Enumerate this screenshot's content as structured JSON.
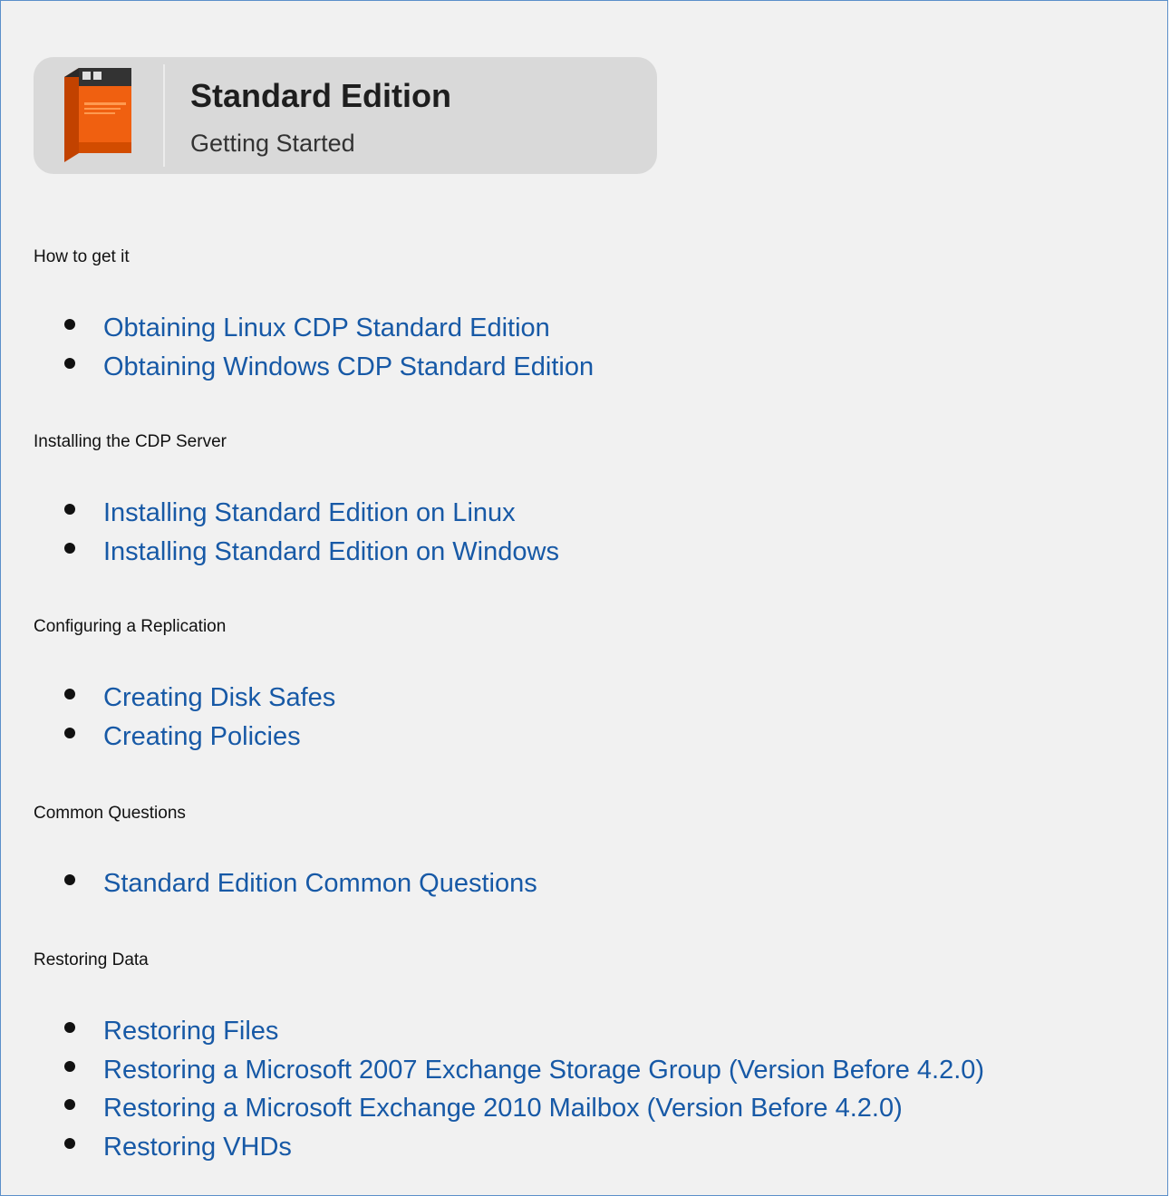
{
  "banner": {
    "title": "Standard Edition",
    "subtitle": "Getting Started",
    "icon": "product-box-icon",
    "colors": {
      "box_front": "#f06010",
      "box_side": "#c24200",
      "box_top": "#2a2a2a"
    }
  },
  "colors": {
    "link": "#1759a6",
    "panel_background": "#f1f1f1",
    "panel_border": "#5b8fca",
    "banner_background": "#d9d9d9"
  },
  "sections": [
    {
      "heading": "How to get it",
      "links": [
        "Obtaining Linux CDP Standard Edition",
        "Obtaining Windows CDP Standard Edition"
      ]
    },
    {
      "heading": "Installing the CDP Server",
      "links": [
        "Installing Standard Edition on Linux",
        "Installing Standard Edition on Windows"
      ]
    },
    {
      "heading": "Configuring a Replication",
      "links": [
        "Creating Disk Safes",
        "Creating Policies"
      ]
    },
    {
      "heading": "Common Questions",
      "links": [
        "Standard Edition Common Questions"
      ]
    },
    {
      "heading": "Restoring Data",
      "links": [
        "Restoring Files",
        "Restoring a Microsoft 2007 Exchange Storage Group (Version Before 4.2.0)",
        "Restoring a Microsoft Exchange 2010 Mailbox (Version Before 4.2.0)",
        "Restoring VHDs"
      ]
    }
  ]
}
